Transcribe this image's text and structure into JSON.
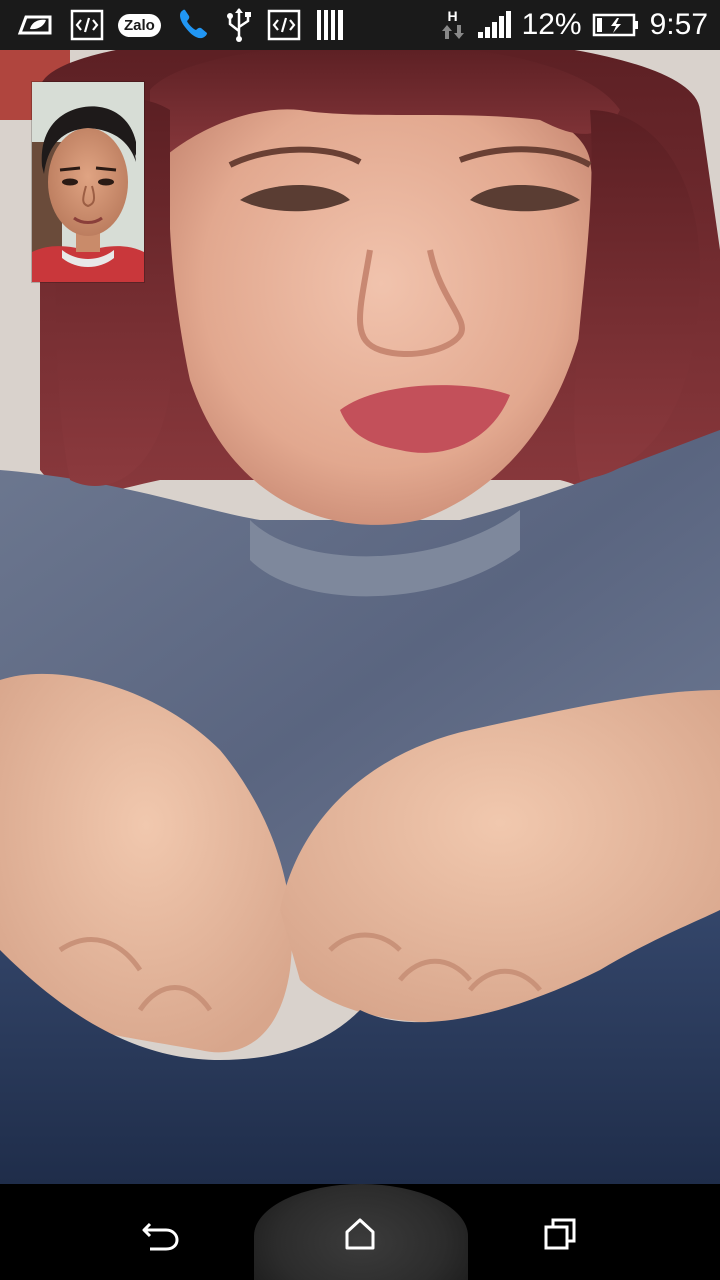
{
  "status_bar": {
    "icons": [
      "cleaner-icon",
      "code-icon",
      "zalo-icon",
      "phone-call-icon",
      "usb-icon",
      "code-icon",
      "barcode-icon"
    ],
    "zalo_label": "Zalo",
    "network_type": "H",
    "signal_icon": "signal-bars-icon",
    "battery_percent": "12%",
    "battery_icon": "battery-charging-icon",
    "time": "9:57"
  },
  "call": {
    "remote_video": "remote-video-feed",
    "self_preview": "self-camera-preview"
  },
  "nav_bar": {
    "back": "back-icon",
    "home": "home-icon",
    "recents": "recents-icon"
  },
  "colors": {
    "status_bar_bg": "#1a1a1a",
    "nav_bar_bg": "#000000",
    "phone_icon_blue": "#2196f3"
  }
}
